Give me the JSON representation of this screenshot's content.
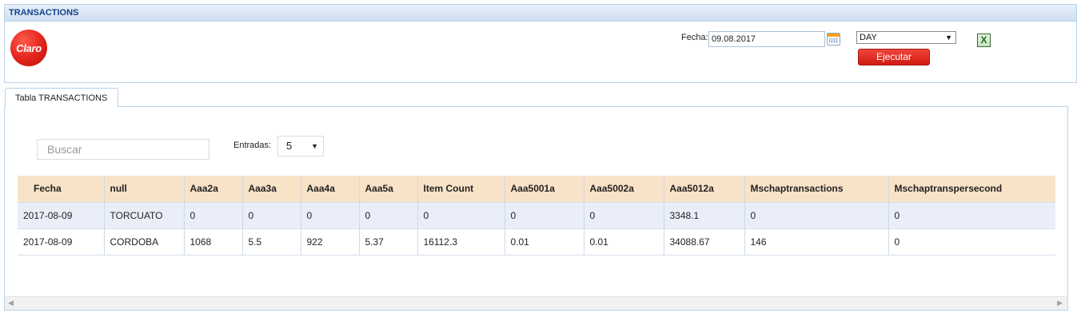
{
  "panel": {
    "title": "TRANSACTIONS"
  },
  "logo": {
    "text": "Claro",
    "brand_color": "#e2231a"
  },
  "filters": {
    "fecha_label": "Fecha:",
    "fecha_value": "09.08.2017",
    "period_value": "DAY",
    "execute_label": "Ejecutar",
    "excel_icon": "excel-export-icon",
    "calendar_icon": "calendar-icon"
  },
  "tab": {
    "label": "Tabla TRANSACTIONS"
  },
  "table_controls": {
    "search_placeholder": "Buscar",
    "entries_label": "Entradas:",
    "entries_value": "5"
  },
  "table": {
    "columns": [
      "Fecha",
      "null",
      "Aaa2a",
      "Aaa3a",
      "Aaa4a",
      "Aaa5a",
      "Item Count",
      "Aaa5001a",
      "Aaa5002a",
      "Aaa5012a",
      "Mschaptransactions",
      "Mschaptranspersecond"
    ],
    "rows": [
      [
        "2017-08-09",
        "TORCUATO",
        "0",
        "0",
        "0",
        "0",
        "0",
        "0",
        "0",
        "3348.1",
        "0",
        "0"
      ],
      [
        "2017-08-09",
        "CORDOBA",
        "1068",
        "5.5",
        "922",
        "5.37",
        "16112.3",
        "0.01",
        "0.01",
        "34088.67",
        "146",
        "0"
      ]
    ]
  },
  "colors": {
    "header_bg": "#f9e3c8",
    "odd_row_bg": "#e9eef8",
    "panel_border": "#b9d2ea",
    "button_red": "#d11a10"
  }
}
